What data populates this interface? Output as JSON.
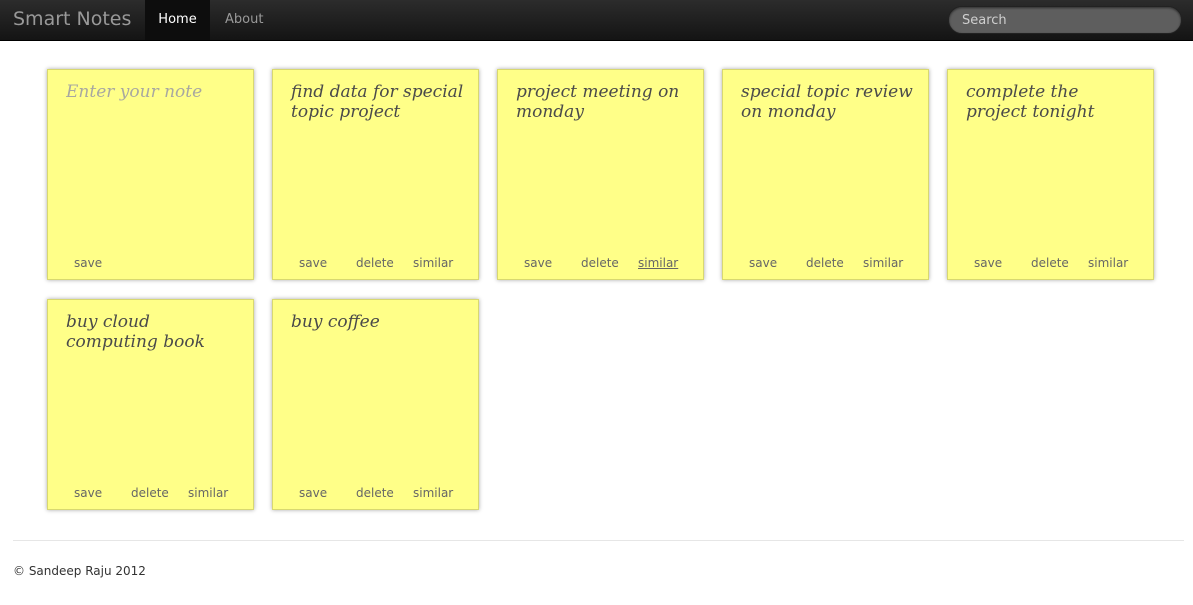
{
  "navbar": {
    "brand": "Smart Notes",
    "items": [
      {
        "label": "Home",
        "active": true
      },
      {
        "label": "About",
        "active": false
      }
    ],
    "search_placeholder": "Search"
  },
  "new_note": {
    "placeholder": "Enter your note",
    "save_label": "save"
  },
  "notes": [
    {
      "text": "find data for special topic project",
      "save": "save",
      "delete": "delete",
      "similar": "similar"
    },
    {
      "text": "project meeting on monday",
      "save": "save",
      "delete": "delete",
      "similar": "similar"
    },
    {
      "text": "special topic review on monday",
      "save": "save",
      "delete": "delete",
      "similar": "similar"
    },
    {
      "text": "complete the project tonight",
      "save": "save",
      "delete": "delete",
      "similar": "similar"
    },
    {
      "text": "buy cloud computing book",
      "save": "save",
      "delete": "delete",
      "similar": "similar"
    },
    {
      "text": "buy coffee",
      "save": "save",
      "delete": "delete",
      "similar": "similar"
    }
  ],
  "colors": {
    "note_bg": "#ffff88",
    "navbar_bg": "#1b1b1b"
  },
  "footer": {
    "copyright": "© Sandeep Raju 2012"
  }
}
